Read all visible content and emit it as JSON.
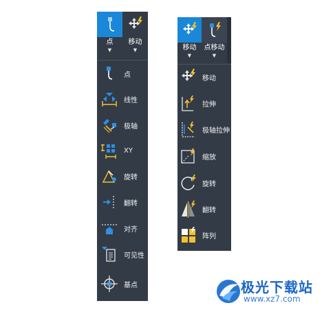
{
  "left_panel": {
    "ribbon": [
      {
        "label": "点",
        "icon": "point-move-icon"
      },
      {
        "label": "移动",
        "icon": "move-icon"
      }
    ],
    "items": [
      {
        "label": "点",
        "icon": "point-icon"
      },
      {
        "label": "线性",
        "icon": "linear-icon"
      },
      {
        "label": "极轴",
        "icon": "polar-icon"
      },
      {
        "label": "XY",
        "icon": "xy-icon"
      },
      {
        "label": "旋转",
        "icon": "rotate-icon"
      },
      {
        "label": "翻转",
        "icon": "flip-icon"
      },
      {
        "label": "对齐",
        "icon": "align-icon"
      },
      {
        "label": "可见性",
        "icon": "visibility-icon"
      },
      {
        "label": "基点",
        "icon": "base-point-icon"
      }
    ]
  },
  "right_panel": {
    "ribbon": [
      {
        "label": "移动",
        "icon": "move-icon"
      },
      {
        "label": "点移动",
        "icon": "point-move-icon"
      }
    ],
    "items": [
      {
        "label": "移动",
        "icon": "move-icon"
      },
      {
        "label": "拉伸",
        "icon": "stretch-icon"
      },
      {
        "label": "极轴拉伸",
        "icon": "polar-stretch-icon"
      },
      {
        "label": "缩放",
        "icon": "scale-icon"
      },
      {
        "label": "旋转",
        "icon": "rotate-icon"
      },
      {
        "label": "翻转",
        "icon": "flip-icon"
      },
      {
        "label": "阵列",
        "icon": "array-icon"
      }
    ]
  },
  "watermark": {
    "name": "极光下载站",
    "url": "www.xz7.com"
  },
  "colors": {
    "panel_bg": "#333b47",
    "active_blue": "#1b87d8",
    "accent_yellow": "#f2c12e",
    "icon_blue": "#2f8fe0"
  }
}
